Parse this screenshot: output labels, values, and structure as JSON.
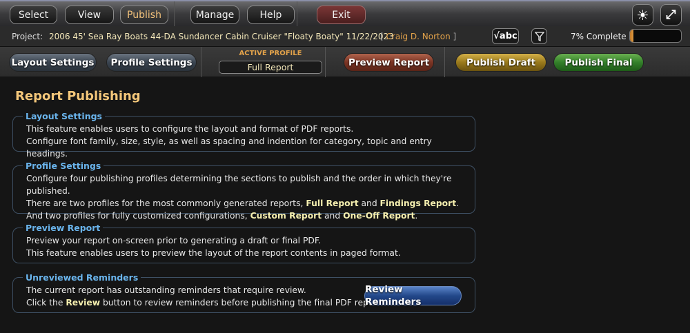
{
  "nav": {
    "select": "Select",
    "view": "View",
    "publish": "Publish",
    "manage": "Manage",
    "help": "Help",
    "exit": "Exit"
  },
  "project": {
    "label": "Project:",
    "name": "2006 45' Sea Ray Boats 44-DA Sundancer Cabin Cruiser \"Floaty Boaty\" 11/22/2023",
    "inspector": "Craig D. Norton",
    "spellcheck": "√abc",
    "progress_label": "7% Complete",
    "progress_percent": 7
  },
  "toolbar": {
    "layout_settings": "Layout Settings",
    "profile_settings": "Profile Settings",
    "active_profile_label": "ACTIVE PROFILE",
    "active_profile_value": "Full Report",
    "preview_report": "Preview Report",
    "publish_draft": "Publish Draft",
    "publish_final": "Publish Final"
  },
  "page": {
    "title": "Report Publishing"
  },
  "sections": {
    "layout": {
      "title": "Layout Settings",
      "line1": "This feature enables users to configure the layout and format of PDF reports.",
      "line2": "Configure font family, size, style, as well as spacing and indention for category, topic and entry headings."
    },
    "profile": {
      "title": "Profile Settings",
      "line1": "Configure four publishing profiles determining the sections to publish and the order in which they're published.",
      "line2a": "There are two profiles for the most commonly generated reports, ",
      "line2b": "Full Report",
      "line2c": " and ",
      "line2d": "Findings Report",
      "line2e": ".",
      "line3a": "And two profiles for fully customized configurations, ",
      "line3b": "Custom Report",
      "line3c": " and ",
      "line3d": "One-Off Report",
      "line3e": "."
    },
    "preview": {
      "title": "Preview Report",
      "line1": "Preview your report on-screen prior to generating a draft or final PDF.",
      "line2": "This feature enables users to preview the layout of the report contents in paged format."
    },
    "reminders": {
      "title": "Unreviewed Reminders",
      "line1": "The current report has outstanding reminders that require review.",
      "line2a": "Click the ",
      "line2b": "Review",
      "line2c": " button to review reminders before publishing the final PDF report.",
      "button": "Review Reminders"
    }
  },
  "colors": {
    "accent": "#f4c77a",
    "section_title": "#6ab4ec",
    "highlight": "#f6f0b0"
  }
}
